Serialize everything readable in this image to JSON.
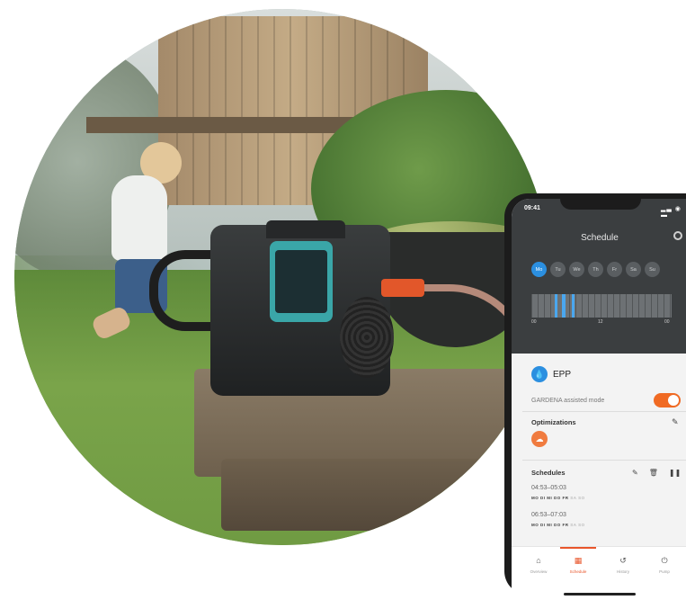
{
  "phone": {
    "status_time": "09:41",
    "status_icons": "▂▃ ◉ ▬",
    "header": {
      "title": "Schedule",
      "days": [
        {
          "label": "Mo",
          "active": true
        },
        {
          "label": "Tu",
          "active": false
        },
        {
          "label": "We",
          "active": false
        },
        {
          "label": "Th",
          "active": false
        },
        {
          "label": "Fr",
          "active": false
        },
        {
          "label": "Sa",
          "active": false
        },
        {
          "label": "Su",
          "active": false
        }
      ],
      "timeline_labels": [
        "00",
        "12",
        "00"
      ]
    },
    "device": {
      "name": "EPP",
      "icon": "water-drop-icon"
    },
    "assisted_mode": {
      "label": "GARDENA assisted mode",
      "enabled": true
    },
    "optimizations": {
      "title": "Optimizations",
      "icon": "optimization-icon"
    },
    "schedules": {
      "title": "Schedules",
      "items": [
        {
          "time": "04:53–05:03",
          "days_on": "MO DI MI DO FR",
          "days_off": "SA SO"
        },
        {
          "time": "06:53–07:03",
          "days_on": "MO DI MI DO FR",
          "days_off": "SA SO"
        }
      ]
    },
    "tabs": [
      {
        "label": "Overview",
        "icon": "home-icon",
        "active": false
      },
      {
        "label": "Schedule",
        "icon": "calendar-icon",
        "active": true
      },
      {
        "label": "History",
        "icon": "history-icon",
        "active": false
      },
      {
        "label": "Pump",
        "icon": "pump-icon",
        "active": false
      }
    ],
    "colors": {
      "accent_orange": "#f06a23",
      "accent_blue": "#2b8fe0",
      "header_dark": "#3b3e40"
    }
  }
}
